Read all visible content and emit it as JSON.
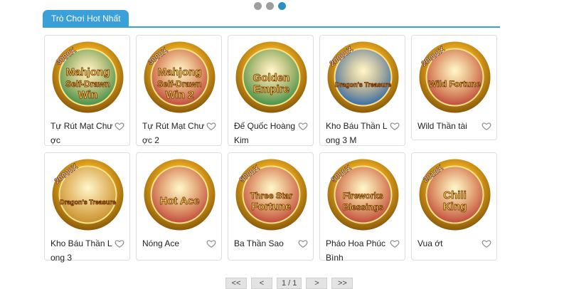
{
  "tab": {
    "label": "Trò Chơi Hot Nhất"
  },
  "carousel": {
    "dots": 3,
    "active_index": 2
  },
  "games": [
    {
      "title": "Tự Rút Mạt Chược",
      "art_text": [
        "Mahjong",
        "Self-Drawn",
        "Win"
      ],
      "badge": "3000X",
      "theme": "#2e8b3a"
    },
    {
      "title": "Tự Rút Mạt Chược 2",
      "art_text": [
        "Mahjong",
        "Self-Drawn",
        "Win 2"
      ],
      "badge": "3000X",
      "theme": "#c0392b"
    },
    {
      "title": "Đế Quốc Hoàng Kim",
      "art_text": [
        "Golden",
        "Empire"
      ],
      "badge": "",
      "theme": "#2e8b3a"
    },
    {
      "title": "Kho Báu Thần Long 3 M",
      "art_text": [
        "Dragon's Treasure"
      ],
      "badge": "20000X",
      "theme": "#1f5fa8"
    },
    {
      "title": "Wild Thần tài",
      "art_text": [
        "Wild Fortune"
      ],
      "badge": "20000X",
      "theme": "#c0392b"
    },
    {
      "title": "Kho Báu Thần Long 3",
      "art_text": [
        "Dragon's Treasure"
      ],
      "badge": "20000X",
      "theme": "#c98a1a"
    },
    {
      "title": "Nóng Ace",
      "art_text": [
        "Hot Ace"
      ],
      "badge": "",
      "theme": "#c0392b"
    },
    {
      "title": "Ba Thần Sao",
      "art_text": [
        "Three Star",
        "Fortune"
      ],
      "badge": "5000X",
      "theme": "#c0392b"
    },
    {
      "title": "Pháo Hoa Phúc Bình",
      "art_text": [
        "Fireworks",
        "Blessings"
      ],
      "badge": "5000X",
      "theme": "#c0392b"
    },
    {
      "title": "Vua ớt",
      "art_text": [
        "Chili",
        "King"
      ],
      "badge": "2010X",
      "theme": "#c0392b"
    }
  ],
  "pagination": {
    "first": "<<",
    "prev": "<",
    "page": "1 / 1",
    "next": ">",
    "last": ">>"
  },
  "colors": {
    "accent": "#3aa0d7",
    "active_dot": "#2b8fc2",
    "dot": "#9e9e9e"
  }
}
